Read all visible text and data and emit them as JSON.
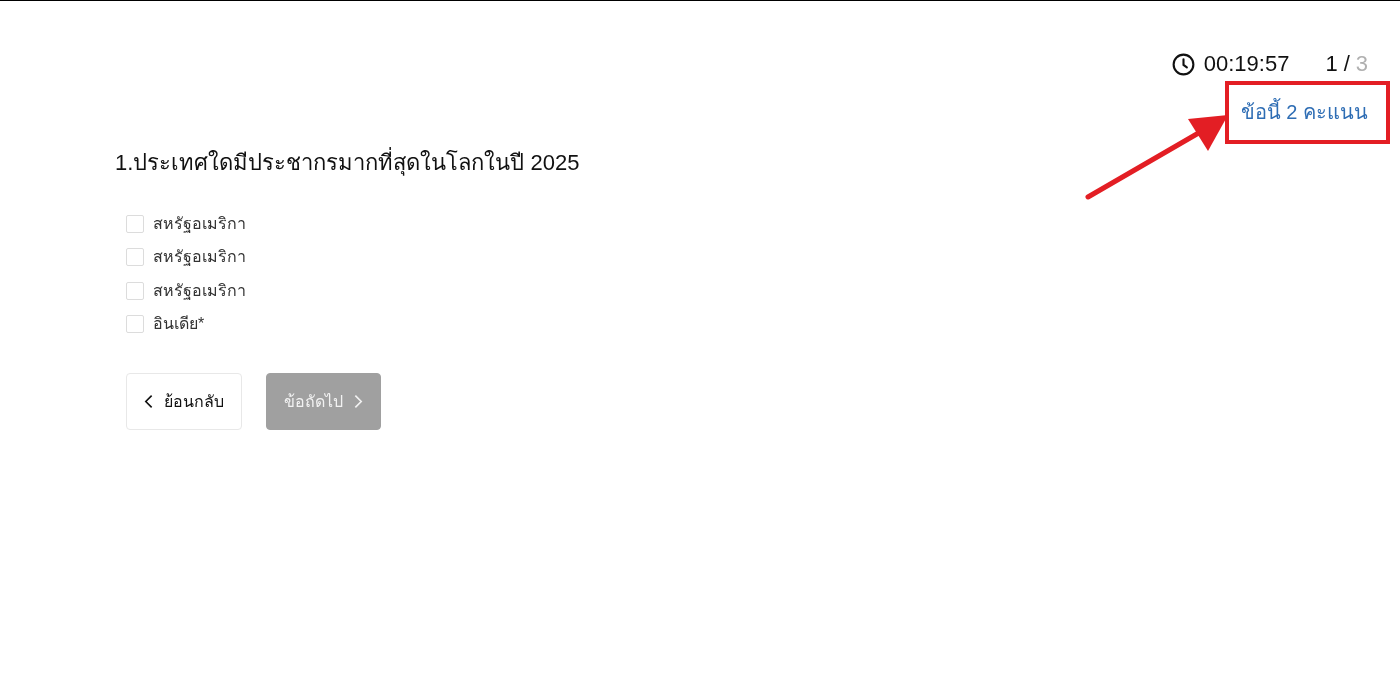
{
  "header": {
    "timer": "00:19:57",
    "progress": {
      "current": "1",
      "separator": "/",
      "total": "3"
    }
  },
  "score": {
    "text": "ข้อนี้ 2 คะแนน",
    "highlighted": true
  },
  "question": {
    "text": "1.ประเทศใดมีประชากรมากที่สุดในโลกในปี 2025"
  },
  "options": [
    {
      "label": "สหรัฐอเมริกา",
      "checked": false
    },
    {
      "label": "สหรัฐอเมริกา",
      "checked": false
    },
    {
      "label": "สหรัฐอเมริกา",
      "checked": false
    },
    {
      "label": "อินเดีย*",
      "checked": false
    }
  ],
  "buttons": [
    {
      "kind": "back",
      "label": "ย้อนกลับ",
      "disabled": false
    },
    {
      "kind": "next",
      "label": "ข้อถัดไป",
      "disabled": true
    }
  ]
}
